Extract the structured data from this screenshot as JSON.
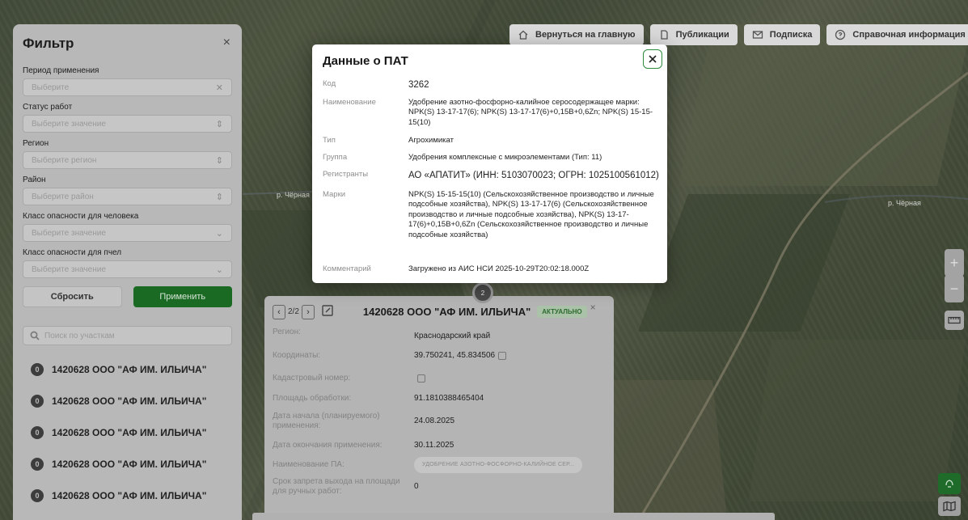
{
  "map": {
    "river_label_1": "р. Чёрная",
    "river_label_2": "р. Чёрная",
    "cluster_count": "2",
    "zoom_in": "+",
    "zoom_out": "−"
  },
  "topnav": {
    "home": "Вернуться на главную",
    "publications": "Публикации",
    "subscription": "Подписка",
    "help": "Справочная информация"
  },
  "filter": {
    "title": "Фильтр",
    "close": "×",
    "period": {
      "label": "Период применения",
      "placeholder": "Выберите"
    },
    "status": {
      "label": "Статус работ",
      "placeholder": "Выберите значение"
    },
    "region": {
      "label": "Регион",
      "placeholder": "Выберите регион"
    },
    "district": {
      "label": "Район",
      "placeholder": "Выберите район"
    },
    "human_hazard": {
      "label": "Класс опасности для человека",
      "placeholder": "Выберите значение"
    },
    "bee_hazard": {
      "label": "Класс опасности для пчел",
      "placeholder": "Выберите значение"
    },
    "reset": "Сбросить",
    "apply": "Применить",
    "search_placeholder": "Поиск по участкам",
    "items": [
      {
        "badge": "0",
        "label": "1420628 ООО \"АФ ИМ. ИЛЬИЧА\""
      },
      {
        "badge": "0",
        "label": "1420628 ООО \"АФ ИМ. ИЛЬИЧА\""
      },
      {
        "badge": "0",
        "label": "1420628 ООО \"АФ ИМ. ИЛЬИЧА\""
      },
      {
        "badge": "0",
        "label": "1420628 ООО \"АФ ИМ. ИЛЬИЧА\""
      },
      {
        "badge": "0",
        "label": "1420628 ООО \"АФ ИМ. ИЛЬИЧА\""
      }
    ]
  },
  "card": {
    "pager": "2/2",
    "title": "1420628 ООО \"АФ ИМ. ИЛЬИЧА\"",
    "status": "АКТУАЛЬНО",
    "close": "×",
    "rows": [
      {
        "key": "Регион:",
        "value": "Краснодарский край"
      },
      {
        "key": "Координаты:",
        "value": "39.750241, 45.834506"
      },
      {
        "key": "Кадастровый номер:",
        "value": ""
      },
      {
        "key": "Площадь обработки:",
        "value": "91.1810388465404"
      },
      {
        "key": "Дата начала (планируемого) применения:",
        "value": "24.08.2025"
      },
      {
        "key": "Дата окончания применения:",
        "value": "30.11.2025"
      },
      {
        "key": "Наименование ПА:",
        "value": "УДОБРЕНИЕ АЗОТНО-ФОСФОРНО-КАЛИЙНОЕ СЕР..."
      },
      {
        "key": "Срок запрета выхода на площади для ручных работ:",
        "value": "0"
      }
    ]
  },
  "modal": {
    "title": "Данные о ПАТ",
    "rows": [
      {
        "key": "Код",
        "value": "3262"
      },
      {
        "key": "Наименование",
        "value": "Удобрение азотно-фосфорно-калийное серосодержащее марки: NPK(S) 13-17-17(6); NPK(S) 13-17-17(6)+0,15B+0,6Zn; NPK(S) 15-15-15(10)"
      },
      {
        "key": "Тип",
        "value": "Агрохимикат"
      },
      {
        "key": "Группа",
        "value": "Удобрения комплексные с микроэлементами (Тип: 11)"
      },
      {
        "key": "Регистранты",
        "value": "АО «АПАТИТ» (ИНН: 5103070023; ОГРН: 1025100561012)"
      },
      {
        "key": "Марки",
        "value": "NPK(S) 15-15-15(10) (Сельскохозяйственное производство и личные подсобные хозяйства), NPK(S) 13-17-17(6) (Сельскохозяйственное производство и личные подсобные хозяйства), NPK(S) 13-17-17(6)+0,15B+0,6Zn (Сельскохозяйственное производство и личные подсобные хозяйства)"
      },
      {
        "key": "Комментарий",
        "value": "Загружено из АИС НСИ 2025-10-29T20:02:18.000Z"
      }
    ]
  }
}
